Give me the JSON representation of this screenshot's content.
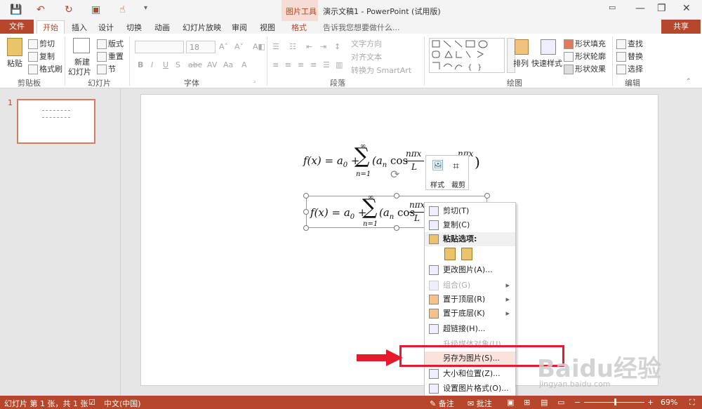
{
  "window": {
    "title": "演示文稿1 - PowerPoint (试用版)",
    "context_tab_group": "图片工具",
    "minimize": "—",
    "restore": "❐",
    "close": "✕"
  },
  "tabs": {
    "file": "文件",
    "items": [
      "开始",
      "插入",
      "设计",
      "切换",
      "动画",
      "幻灯片放映",
      "审阅",
      "视图",
      "格式"
    ],
    "tell_me": "告诉我您想要做什么...",
    "share": "共享"
  },
  "ribbon": {
    "clipboard": {
      "paste": "粘贴",
      "cut": "剪切",
      "copy": "复制",
      "format_painter": "格式刷",
      "group": "剪贴板"
    },
    "slides": {
      "new_slide_1": "新建",
      "new_slide_2": "幻灯片",
      "layout": "版式",
      "reset": "重置",
      "section": "节",
      "group": "幻灯片"
    },
    "font": {
      "size": "18",
      "group": "字体"
    },
    "paragraph": {
      "text_direction": "文字方向",
      "align_text": "对齐文本",
      "smartart": "转换为 SmartArt",
      "group": "段落"
    },
    "drawing": {
      "arrange": "排列",
      "quick_styles": "快速样式",
      "shape_fill": "形状填充",
      "shape_outline": "形状轮廓",
      "shape_effects": "形状效果",
      "group": "绘图"
    },
    "editing": {
      "find": "查找",
      "replace": "替换",
      "select": "选择",
      "group": "编辑"
    }
  },
  "thumbnail": {
    "number": "1"
  },
  "formulas": {
    "f1_lhs": "f(x) = a",
    "f1_sub": "0",
    "f1_plus": "+",
    "sum_top": "∞",
    "sum_bottom": "n=1",
    "f1_term": "(a",
    "f1_n": "n",
    "cos": "cos",
    "frac_num": "nπx",
    "frac_den": "L",
    "f1_tail_num": "nπx",
    "f1_close": ")"
  },
  "mini_toolbar": {
    "style": "样式",
    "crop": "裁剪"
  },
  "context_menu": {
    "items": [
      {
        "label": "剪切(T)",
        "enabled": true
      },
      {
        "label": "复制(C)",
        "enabled": true
      },
      {
        "label": "粘贴选项:",
        "enabled": true
      },
      {
        "label": "更改图片(A)...",
        "enabled": true
      },
      {
        "label": "组合(G)",
        "enabled": false
      },
      {
        "label": "置于顶层(R)",
        "enabled": true
      },
      {
        "label": "置于底层(K)",
        "enabled": true
      },
      {
        "label": "超链接(H)...",
        "enabled": true
      },
      {
        "label": "升级媒体对象(U)",
        "enabled": false
      },
      {
        "label": "另存为图片(S)...",
        "enabled": true
      },
      {
        "label": "大小和位置(Z)...",
        "enabled": true
      },
      {
        "label": "设置图片格式(O)...",
        "enabled": true
      }
    ]
  },
  "statusbar": {
    "slide_info": "幻灯片 第 1 张，共 1 张",
    "language": "中文(中国)",
    "notes": "备注",
    "comments": "批注",
    "zoom": "69%"
  },
  "watermark": {
    "brand": "Baidu经验",
    "url": "jingyan.baidu.com"
  },
  "colors": {
    "accent": "#b7472a",
    "highlight_box": "#e8192c",
    "menu_highlight": "#fbe3dd"
  }
}
